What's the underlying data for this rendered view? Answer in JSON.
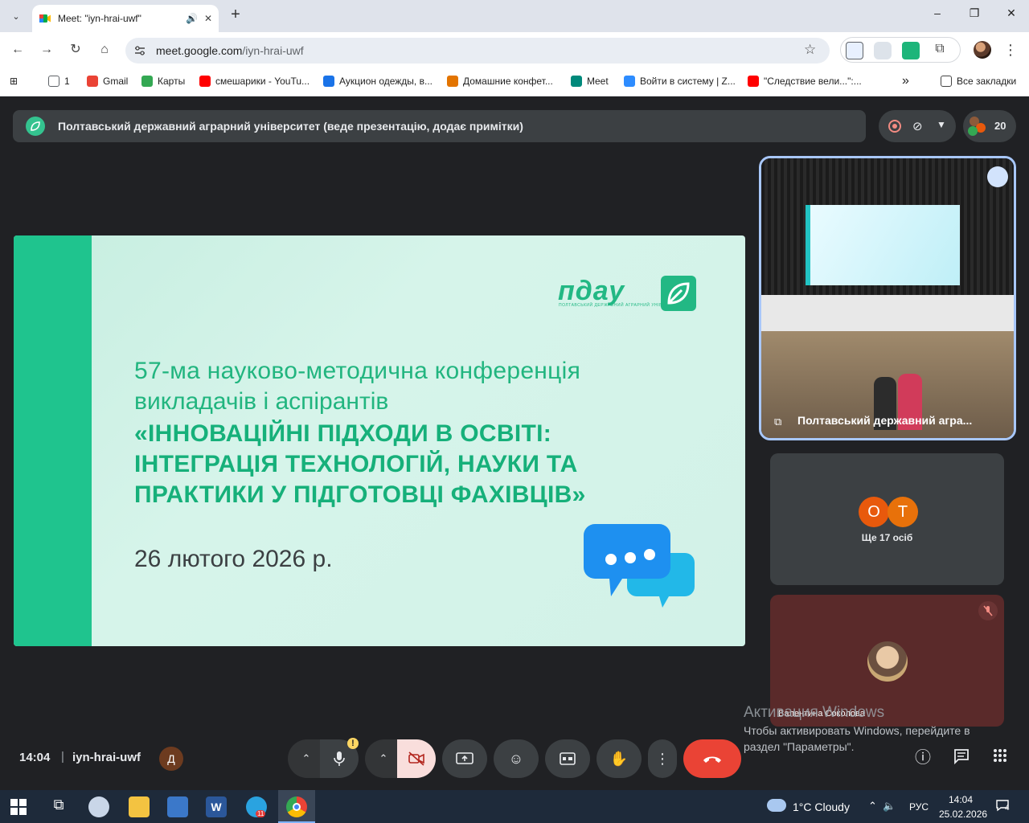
{
  "browser": {
    "tab_title": "Meet: \"iyn-hrai-uwf\"",
    "new_tab_label": "+",
    "url_host": "meet.google.com",
    "url_path": "/iyn-hrai-uwf",
    "window_minimize": "–",
    "window_restore": "❐",
    "window_close": "✕"
  },
  "bookmarks": [
    {
      "label": "1",
      "icon": "folder-icon",
      "color": "#5f6368"
    },
    {
      "label": "Gmail",
      "icon": "gmail-icon",
      "color": "#ea4335"
    },
    {
      "label": "Карты",
      "icon": "maps-icon",
      "color": "#34a853"
    },
    {
      "label": "смешарики - YouTu...",
      "icon": "youtube-icon",
      "color": "#ff0000"
    },
    {
      "label": "Аукцион одежды, в...",
      "icon": "globe-icon",
      "color": "#1a73e8"
    },
    {
      "label": "Домашние конфет...",
      "icon": "site-icon",
      "color": "#e37400"
    },
    {
      "label": "Meet",
      "icon": "meet-icon",
      "color": "#00897b"
    },
    {
      "label": "Войти в систему | Z...",
      "icon": "zoom-icon",
      "color": "#2d8cff"
    },
    {
      "label": "\"Следствие вели...\":...",
      "icon": "youtube-icon",
      "color": "#ff0000"
    }
  ],
  "bookmarks_more": "»",
  "bookmarks_all": "Все закладки",
  "meet": {
    "presenter_text": "Полтавський державний аграрний університет (веде презентацію, додає примітки)",
    "people_count": "20",
    "slide": {
      "logo": "пдау",
      "logo_sub": "ПОЛТАВСЬКИЙ ДЕРЖАВНИЙ АГРАРНИЙ УНІВЕРСИТЕТ",
      "line1": "57-ма науково-методична конференція",
      "line2": "викладачів і аспірантів",
      "bold1": "«ІННОВАЦІЙНІ ПІДХОДИ В ОСВІТІ:",
      "bold2": "ІНТЕГРАЦІЯ ТЕХНОЛОГІЙ, НАУКИ ТА",
      "bold3": "ПРАКТИКИ У ПІДГОТОВЦІ ФАХІВЦІВ»",
      "date": "26 лютого 2026 р."
    },
    "main_tile_name": "Полтавський державний агра...",
    "others": {
      "avatar1": "О",
      "avatar1_color": "#e8590c",
      "avatar2": "Т",
      "avatar2_color": "#e8710a",
      "label": "Ще 17 осіб"
    },
    "valentina_name": "Валентина Соколова",
    "time": "14:04",
    "separator": "|",
    "code": "iyn-hrai-uwf",
    "host_badge": "Д",
    "warning_mark": "!"
  },
  "windows_activation": {
    "title": "Активация Windows",
    "line1": "Чтобы активировать Windows, перейдите в",
    "line2": "раздел \"Параметры\"."
  },
  "taskbar": {
    "weather": "1°C  Cloudy",
    "language": "РУС",
    "time": "14:04",
    "date": "25.02.2026",
    "notifications": "4",
    "telegram_badge": "11"
  }
}
